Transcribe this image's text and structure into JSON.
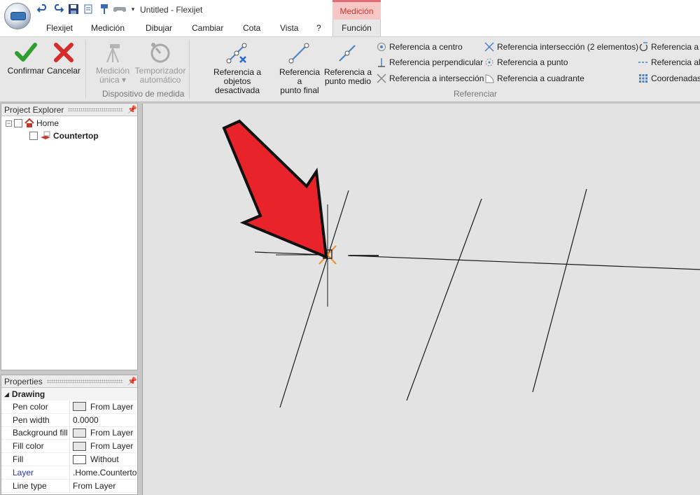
{
  "window": {
    "title": "Untitled - Flexijet",
    "context_tab_header": "Medición"
  },
  "tabs": [
    "Flexijet",
    "Medición",
    "Dibujar",
    "Cambiar",
    "Cota",
    "Vista",
    "?",
    "Función"
  ],
  "active_tab": "Función",
  "ribbon": {
    "confirm_label": "Confirmar",
    "cancel_label": "Cancelar",
    "single_measure_label_1": "Medición",
    "single_measure_label_2": "única ▾",
    "timer_label_1": "Temporizador",
    "timer_label_2": "automático",
    "group_device_label": "Dispositivo de medida",
    "ref_objects_label_1": "Referencia a objetos",
    "ref_objects_label_2": "desactivada",
    "ref_endpoint_label_1": "Referencia a",
    "ref_endpoint_label_2": "punto final",
    "ref_midpoint_label_1": "Referencia a",
    "ref_midpoint_label_2": "punto medio",
    "small_col1": [
      "Referencia a centro",
      "Referencia perpendicular",
      "Referencia a intersección"
    ],
    "small_col2": [
      "Referencia intersección (2 elementos)",
      "Referencia a punto",
      "Referencia a cuadrante"
    ],
    "small_col3": [
      "Referencia a t",
      "Referencia al",
      "Coordenadas"
    ],
    "group_reference_label": "Referenciar"
  },
  "project_explorer": {
    "title": "Project Explorer",
    "tree": [
      {
        "label": "Home",
        "level": 0
      },
      {
        "label": "Countertop",
        "level": 1
      }
    ]
  },
  "properties": {
    "title": "Properties",
    "category": "Drawing",
    "rows": [
      {
        "label": "Pen color",
        "value": "From Layer",
        "swatch": "gray"
      },
      {
        "label": "Pen width",
        "value": "0.0000",
        "swatch": ""
      },
      {
        "label": "Background fill",
        "value": "From Layer",
        "swatch": "gray"
      },
      {
        "label": "Fill color",
        "value": "From Layer",
        "swatch": "gray"
      },
      {
        "label": "Fill",
        "value": "Without",
        "swatch": "white"
      },
      {
        "label": "Layer",
        "value": ".Home.Countertop",
        "swatch": ""
      },
      {
        "label": "Line type",
        "value": "From Layer",
        "swatch": ""
      }
    ]
  },
  "colors": {
    "accent_red": "#e8232a",
    "snap_marker": "#f08a24",
    "confirm_green": "#2f9e2f",
    "cancel_red": "#d42b2b"
  }
}
